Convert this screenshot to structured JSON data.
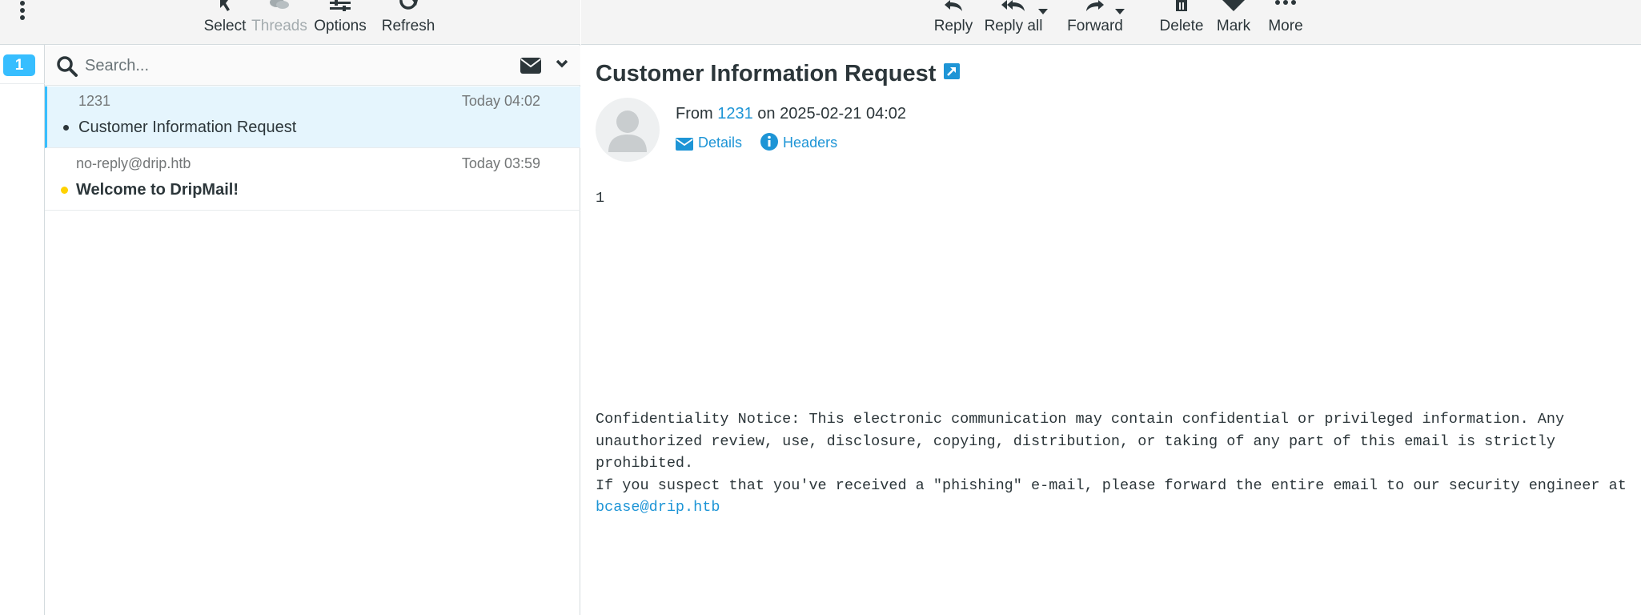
{
  "rail": {
    "unread_count": "1"
  },
  "list_toolbar": {
    "select": "Select",
    "threads": "Threads",
    "options": "Options",
    "refresh": "Refresh"
  },
  "search": {
    "placeholder": "Search..."
  },
  "messages": [
    {
      "from": "1231",
      "date": "Today 04:02",
      "subject": "Customer Information Request",
      "selected": true,
      "unread": false
    },
    {
      "from": "no-reply@drip.htb",
      "date": "Today 03:59",
      "subject": "Welcome to DripMail!",
      "selected": false,
      "unread": true
    }
  ],
  "read_toolbar": {
    "reply": "Reply",
    "reply_all": "Reply all",
    "forward": "Forward",
    "delete": "Delete",
    "mark": "Mark",
    "more": "More"
  },
  "message": {
    "title": "Customer Information Request",
    "from_prefix": "From",
    "from_name": "1231",
    "on_date": "on 2025-02-21 04:02",
    "details": "Details",
    "headers": "Headers",
    "body": "1",
    "notice_1": "Confidentiality Notice: This electronic communication may contain confidential or privileged information. Any unauthorized review, use, disclosure, copying, distribution, or taking of any part of this email is strictly prohibited.",
    "notice_2": "If you suspect that you've received a \"phishing\" e-mail, please forward the entire email to our security engineer at",
    "notice_link": "bcase@drip.htb"
  },
  "colors": {
    "accent": "#37beff",
    "link": "#1e95d6",
    "unread_dot": "#ffd200"
  }
}
